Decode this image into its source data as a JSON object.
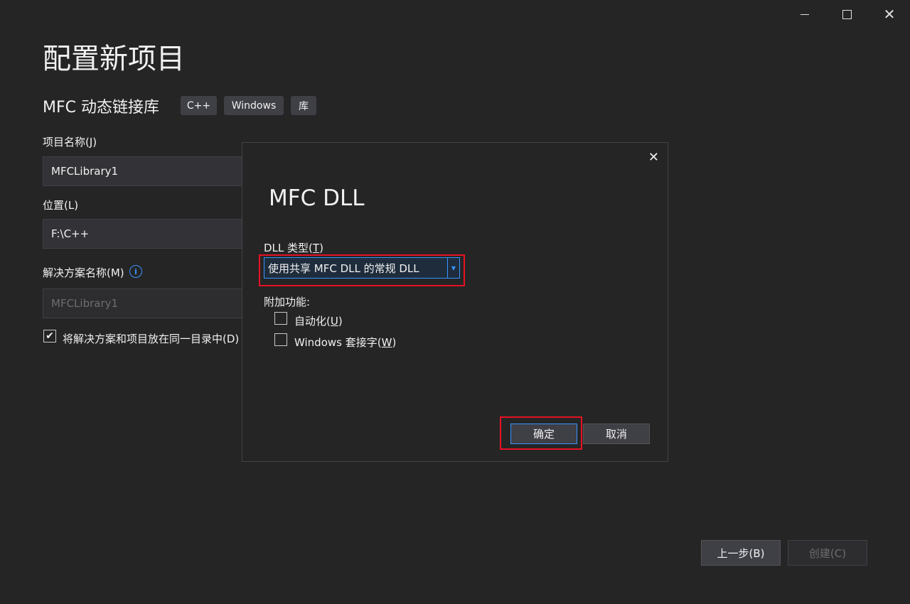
{
  "window": {
    "title": "配置新项目",
    "template_name": "MFC 动态链接库",
    "tags": [
      "C++",
      "Windows",
      "库"
    ]
  },
  "form": {
    "project_name_label": "项目名称(J)",
    "project_name_value": "MFCLibrary1",
    "location_label": "位置(L)",
    "location_value": "F:\\C++",
    "solution_name_label": "解决方案名称(M)",
    "solution_name_value": "MFCLibrary1",
    "same_dir_label": "将解决方案和项目放在同一目录中(D)",
    "same_dir_checked": true
  },
  "footer": {
    "back_label": "上一步(B)",
    "create_label": "创建(C)"
  },
  "dialog": {
    "title": "MFC DLL",
    "dll_type_label": "DLL 类型(T)",
    "dll_type_value": "使用共享 MFC DLL 的常规 DLL",
    "extra_label": "附加功能:",
    "automation_label": "自动化(U)",
    "automation_checked": false,
    "sockets_label": "Windows 套接字(W)",
    "sockets_checked": false,
    "ok_label": "确定",
    "cancel_label": "取消"
  },
  "colors": {
    "background": "#252526",
    "accent": "#3794ff",
    "highlight_red": "#e81123"
  }
}
